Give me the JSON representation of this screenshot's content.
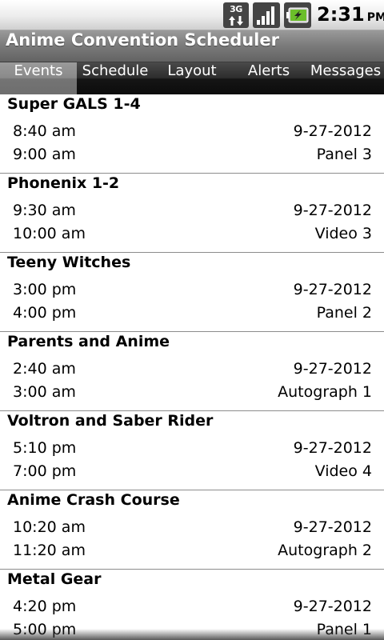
{
  "status_bar": {
    "network": "3G",
    "time": "2:31",
    "ampm": "PM",
    "icons": [
      "3g-data-icon",
      "signal-strength-icon",
      "battery-charging-icon"
    ]
  },
  "app": {
    "title": "Anime Convention Scheduler"
  },
  "tabs": [
    {
      "label": "Events",
      "selected": true
    },
    {
      "label": "Schedule",
      "selected": false
    },
    {
      "label": "Layout",
      "selected": false
    },
    {
      "label": "Alerts",
      "selected": false
    },
    {
      "label": "Messages",
      "selected": false
    }
  ],
  "events": [
    {
      "title": "Super GALS 1-4",
      "start": "8:40 am",
      "end": "9:00 am",
      "date": "9-27-2012",
      "room": "Panel 3"
    },
    {
      "title": "Phonenix 1-2",
      "start": "9:30 am",
      "end": "10:00 am",
      "date": "9-27-2012",
      "room": "Video 3"
    },
    {
      "title": "Teeny Witches",
      "start": "3:00 pm",
      "end": "4:00 pm",
      "date": "9-27-2012",
      "room": "Panel 2"
    },
    {
      "title": "Parents and Anime",
      "start": "2:40 am",
      "end": "3:00 am",
      "date": "9-27-2012",
      "room": "Autograph 1"
    },
    {
      "title": "Voltron and Saber Rider",
      "start": "5:10 pm",
      "end": "7:00 pm",
      "date": "9-27-2012",
      "room": "Video 4"
    },
    {
      "title": "Anime Crash Course",
      "start": "10:20 am",
      "end": "11:20 am",
      "date": "9-27-2012",
      "room": "Autograph 2"
    },
    {
      "title": "Metal Gear",
      "start": "4:20 pm",
      "end": "5:00 pm",
      "date": "9-27-2012",
      "room": "Panel 1"
    }
  ]
}
